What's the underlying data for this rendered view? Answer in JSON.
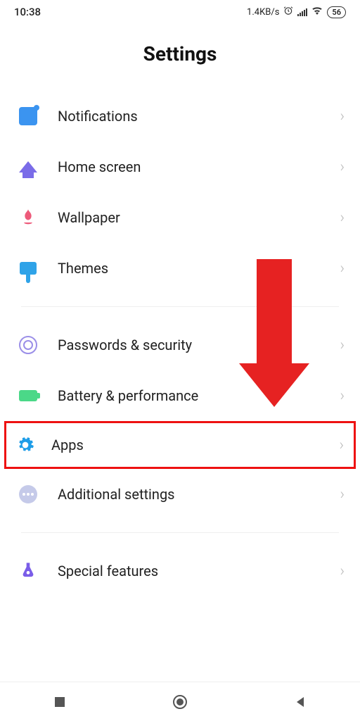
{
  "statusBar": {
    "time": "10:38",
    "speed": "1.4KB/s",
    "battery": "56"
  },
  "header": {
    "title": "Settings"
  },
  "groups": [
    {
      "items": [
        {
          "id": "notifications",
          "label": "Notifications"
        },
        {
          "id": "home-screen",
          "label": "Home screen"
        },
        {
          "id": "wallpaper",
          "label": "Wallpaper"
        },
        {
          "id": "themes",
          "label": "Themes"
        }
      ]
    },
    {
      "items": [
        {
          "id": "passwords-security",
          "label": "Passwords & security"
        },
        {
          "id": "battery-performance",
          "label": "Battery & performance"
        },
        {
          "id": "apps",
          "label": "Apps",
          "highlighted": true
        },
        {
          "id": "additional-settings",
          "label": "Additional settings"
        }
      ]
    },
    {
      "items": [
        {
          "id": "special-features",
          "label": "Special features"
        }
      ]
    }
  ],
  "annotation": {
    "arrowTarget": "apps",
    "color": "#e62222"
  }
}
